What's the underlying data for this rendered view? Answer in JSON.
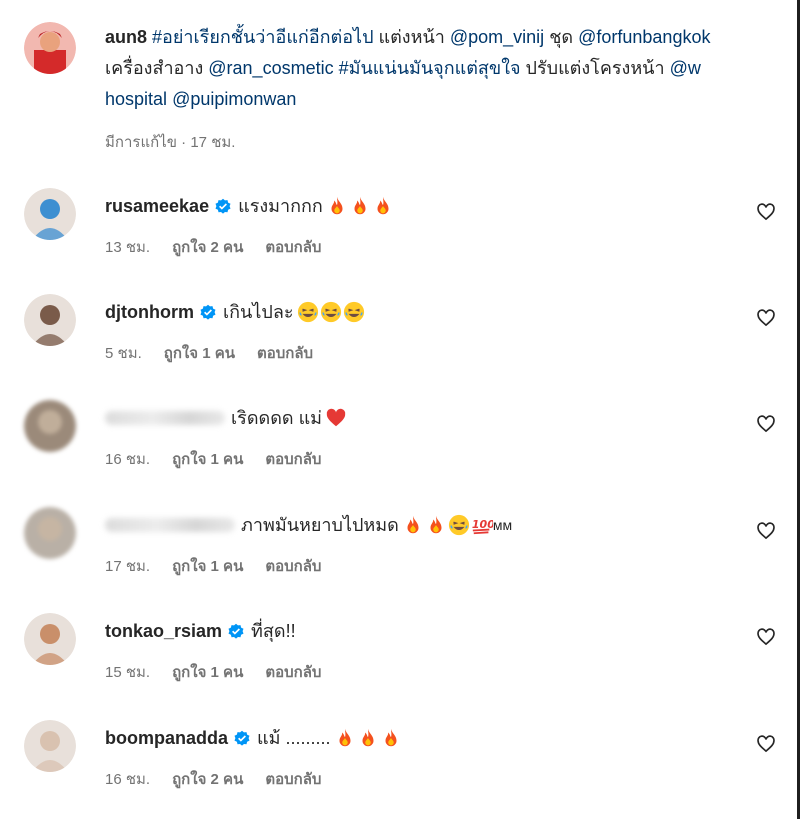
{
  "post": {
    "username": "aun8",
    "caption_parts": [
      {
        "text": "#อย่าเรียกชั้นว่าอีแก่อีกต่อไป",
        "tag": true
      },
      {
        "text": " แต่งหน้า ",
        "tag": false
      },
      {
        "text": "@pom_vinij",
        "tag": true
      },
      {
        "text": " ชุด ",
        "tag": false
      },
      {
        "text": "@forfunbangkok",
        "tag": true
      },
      {
        "text": " เครื่องสำอาง ",
        "tag": false
      },
      {
        "text": "@ran_cosmetic",
        "tag": true
      },
      {
        "text": " ",
        "tag": false
      },
      {
        "text": "#มันแน่นมันจุกแต่สุขใจ",
        "tag": true
      },
      {
        "text": " ปรับแต่งโครงหน้า ",
        "tag": false
      },
      {
        "text": "@w hospital",
        "tag": true
      },
      {
        "text": " ",
        "tag": false
      },
      {
        "text": "@puipimonwan",
        "tag": true
      }
    ],
    "edited_label": "มีการแก้ไข",
    "separator": "·",
    "time": "17 ชม."
  },
  "comments": [
    {
      "username": "rusameekae",
      "verified": true,
      "blurred": false,
      "text": "แรงมากกก",
      "emojis": [
        "fire",
        "fire",
        "fire"
      ],
      "suffix": "",
      "time": "13 ชม.",
      "likes": "ถูกใจ 2 คน",
      "reply": "ตอบกลับ",
      "avatar_color": "#3d8fd1"
    },
    {
      "username": "djtonhorm",
      "verified": true,
      "blurred": false,
      "text": "เกินไปละ",
      "emojis": [
        "laugh",
        "laugh",
        "laugh"
      ],
      "suffix": "",
      "time": "5 ชม.",
      "likes": "ถูกใจ 1 คน",
      "reply": "ตอบกลับ",
      "avatar_color": "#7a5b4a"
    },
    {
      "username": "",
      "verified": false,
      "blurred": true,
      "text": "เริดดดด แม่",
      "emojis": [
        "heart"
      ],
      "suffix": "",
      "time": "16 ชม.",
      "likes": "ถูกใจ 1 คน",
      "reply": "ตอบกลับ",
      "avatar_color": "#9b8a7a"
    },
    {
      "username": "",
      "verified": false,
      "blurred": true,
      "text": "ภาพมันหยาบไปหมด",
      "emojis": [
        "fire",
        "fire",
        "laugh",
        "hundred"
      ],
      "suffix": " мм",
      "time": "17 ชม.",
      "likes": "ถูกใจ 1 คน",
      "reply": "ตอบกลับ",
      "avatar_color": "#b9b0a6"
    },
    {
      "username": "tonkao_rsiam",
      "verified": true,
      "blurred": false,
      "text": "ที่สุด!!",
      "emojis": [],
      "suffix": "",
      "time": "15 ชม.",
      "likes": "ถูกใจ 1 คน",
      "reply": "ตอบกลับ",
      "avatar_color": "#c98f6a"
    },
    {
      "username": "boompanadda",
      "verified": true,
      "blurred": false,
      "text": "แม้ .........",
      "emojis": [
        "fire",
        "fire",
        "fire"
      ],
      "suffix": "",
      "time": "16 ชม.",
      "likes": "ถูกใจ 2 คน",
      "reply": "ตอบกลับ",
      "avatar_color": "#d9c2b0"
    }
  ],
  "colors": {
    "text": "#262626",
    "secondary": "#737373",
    "link": "#00376b",
    "verified": "#0095f6"
  }
}
